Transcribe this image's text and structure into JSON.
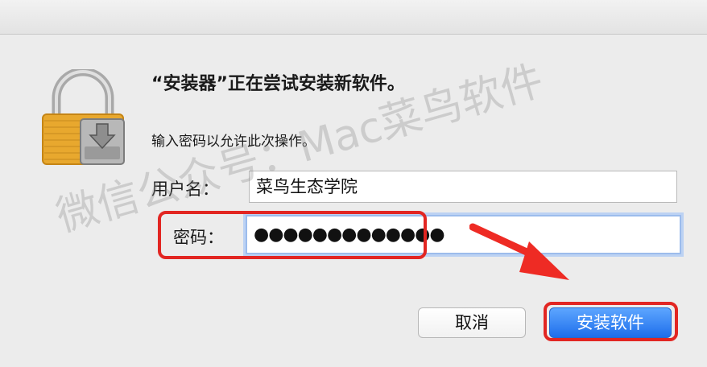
{
  "dialog": {
    "title": "“安装器”正在尝试安装新软件。",
    "info": "输入密码以允许此次操作。",
    "username_label": "用户名：",
    "username_value": "菜鸟生态学院",
    "password_label": "密码：",
    "password_value": "●●●●●●●●●●●●●",
    "cancel_label": "取消",
    "install_label": "安装软件"
  },
  "watermark": "微信公众号：Mac菜鸟软件",
  "colors": {
    "highlight": "#e22622",
    "primary_button": "#1e6eeb",
    "focus_ring": "#9cbcec"
  },
  "icons": {
    "lock": "padlock-with-installer-icon",
    "arrow": "red-annotation-arrow"
  }
}
